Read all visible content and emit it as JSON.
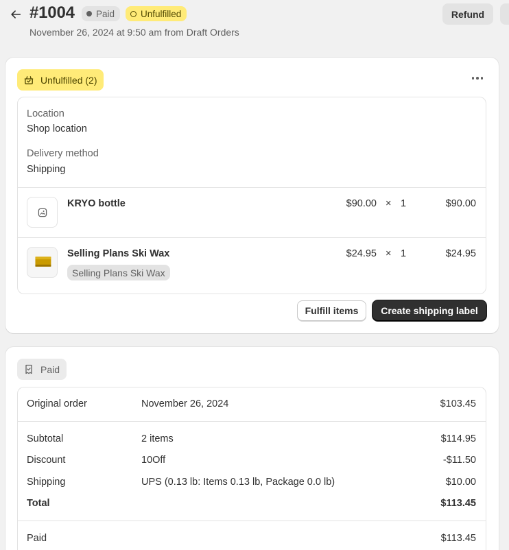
{
  "header": {
    "order_number": "#1004",
    "payment_badge": "Paid",
    "fulfillment_badge": "Unfulfilled",
    "subtitle": "November 26, 2024 at 9:50 am from Draft Orders",
    "refund_label": "Refund"
  },
  "fulfillment_card": {
    "status_label": "Unfulfilled (2)",
    "location_label": "Location",
    "location_value": "Shop location",
    "delivery_label": "Delivery method",
    "delivery_value": "Shipping",
    "items": [
      {
        "name": "KRYO bottle",
        "price": "$90.00",
        "times": "×",
        "quantity": "1",
        "total": "$90.00",
        "variant": ""
      },
      {
        "name": "Selling Plans Ski Wax",
        "price": "$24.95",
        "times": "×",
        "quantity": "1",
        "total": "$24.95",
        "variant": "Selling Plans Ski Wax"
      }
    ],
    "fulfill_button": "Fulfill items",
    "shipping_label_button": "Create shipping label"
  },
  "payment_card": {
    "status_label": "Paid",
    "original_order_label": "Original order",
    "original_order_date": "November 26, 2024",
    "original_order_amount": "$103.45",
    "rows": [
      {
        "label": "Subtotal",
        "detail": "2 items",
        "amount": "$114.95"
      },
      {
        "label": "Discount",
        "detail": "10Off",
        "amount": "-$11.50"
      },
      {
        "label": "Shipping",
        "detail": "UPS (0.13 lb: Items 0.13 lb, Package 0.0 lb)",
        "amount": "$10.00"
      }
    ],
    "total_label": "Total",
    "total_amount": "$113.45",
    "paid_label": "Paid",
    "paid_amount": "$113.45"
  },
  "colors": {
    "background": "#f1f1f1",
    "unfulfilled_yellow": "#ffeb78",
    "primary_button": "#303030"
  },
  "icons": [
    "arrow-left-icon",
    "dot-icon",
    "circle-outline-icon",
    "package-icon",
    "more-horizontal-icon",
    "image-placeholder-icon",
    "receipt-icon"
  ]
}
